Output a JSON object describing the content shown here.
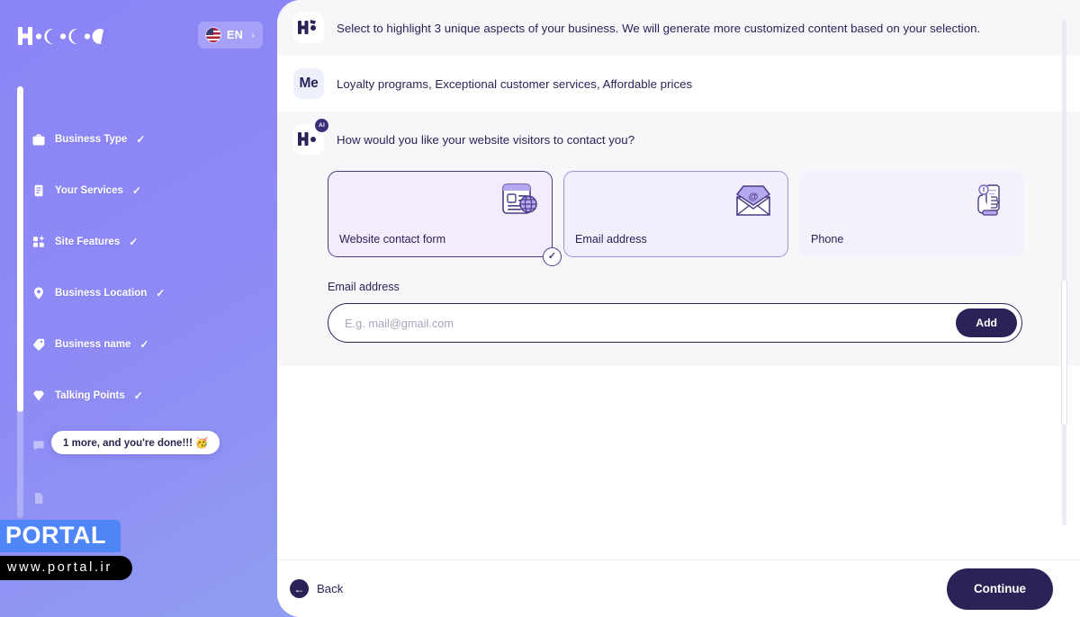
{
  "brand": {
    "logo_text": "HOCOOS",
    "logo_icon": "hocoos-wordmark"
  },
  "language": {
    "code": "EN",
    "flag": "us-flag-icon",
    "chevron": "›"
  },
  "sidebar": {
    "steps": [
      {
        "label": "Business Type",
        "icon": "briefcase-icon",
        "done": true,
        "check": "✓"
      },
      {
        "label": "Your Services",
        "icon": "list-document-icon",
        "done": true,
        "check": "✓"
      },
      {
        "label": "Site Features",
        "icon": "grid-plus-icon",
        "done": true,
        "check": "✓"
      },
      {
        "label": "Business Location",
        "icon": "map-pin-icon",
        "done": true,
        "check": "✓"
      },
      {
        "label": "Business name",
        "icon": "tag-icon",
        "done": true,
        "check": "✓"
      },
      {
        "label": "Talking Points",
        "icon": "diamond-icon",
        "done": true,
        "check": "✓"
      },
      {
        "label": "",
        "icon": "chat-bubble-icon",
        "done": false,
        "check": ""
      },
      {
        "label": "",
        "icon": "page-icon",
        "done": false,
        "check": ""
      }
    ],
    "tooltip": "1 more, and you're done!!! 🥳"
  },
  "watermark": {
    "name": "PORTAL",
    "url": "www.portal.ir"
  },
  "conversation": [
    {
      "role": "bot",
      "avatar": "hocoos-logo-avatar",
      "badge": "",
      "text": "Select to highlight 3 unique aspects of your business. We will generate more customized content based on your selection."
    },
    {
      "role": "me",
      "avatar": "me-avatar",
      "avatar_text": "Me",
      "badge": "",
      "text": "Loyalty programs, Exceptional customer services, Affordable prices"
    },
    {
      "role": "bot",
      "avatar": "hocoos-logo-avatar",
      "badge": "AI",
      "text": "How would you like your website visitors to contact you?"
    }
  ],
  "contact_options": [
    {
      "label": "Website contact form",
      "icon": "website-form-icon",
      "state": "selected",
      "check": "✓"
    },
    {
      "label": "Email address",
      "icon": "email-envelope-icon",
      "state": "outlined",
      "check": ""
    },
    {
      "label": "Phone",
      "icon": "hand-phone-icon",
      "state": "ghost",
      "check": ""
    }
  ],
  "email_field": {
    "label": "Email address",
    "value": "",
    "placeholder": "E.g. mail@gmail.com",
    "add_label": "Add"
  },
  "footer": {
    "back_label": "Back",
    "back_icon": "arrow-left-circle-icon",
    "continue_label": "Continue"
  },
  "colors": {
    "brand_navy": "#2b2358",
    "accent_purple": "#8b84f7",
    "card_selected_bg": "#f2ecfd",
    "tint_row": "#f7f7fa"
  }
}
